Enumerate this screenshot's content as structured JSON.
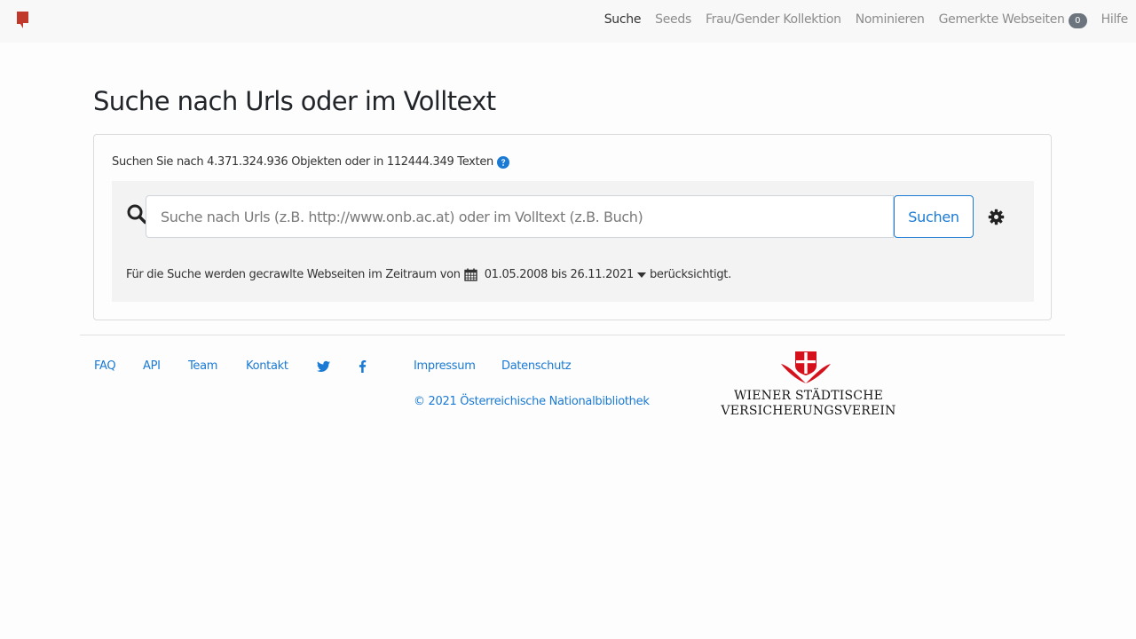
{
  "navbar": {
    "items": [
      {
        "label": "Suche",
        "active": true
      },
      {
        "label": "Seeds"
      },
      {
        "label": "Frau/Gender Kollektion"
      },
      {
        "label": "Nominieren"
      },
      {
        "label": "Gemerkte Webseiten",
        "badge": "0"
      },
      {
        "label": "Hilfe"
      }
    ]
  },
  "page": {
    "title": "Suche nach Urls oder im Volltext"
  },
  "search": {
    "stats_text": "Suchen Sie nach 4.371.324.936 Objekten oder in 112444.349 Texten",
    "placeholder": "Suche nach Urls (z.B. http://www.onb.ac.at) oder im Volltext (z.B. Buch)",
    "value": "",
    "button_label": "Suchen",
    "range_prefix": "Für die Suche werden gecrawlte Webseiten im Zeitraum von",
    "range_dates": "01.05.2008 bis 26.11.2021",
    "range_suffix": "berücksichtigt."
  },
  "footer": {
    "links": [
      {
        "label": "FAQ"
      },
      {
        "label": "API"
      },
      {
        "label": "Team"
      },
      {
        "label": "Kontakt"
      }
    ],
    "legal_links": [
      {
        "label": "Impressum"
      },
      {
        "label": "Datenschutz"
      }
    ],
    "copyright": "© 2021 Österreichische Nationalbibliothek",
    "sponsor_line1": "WIENER STÄDTISCHE",
    "sponsor_line2": "VERSICHERUNGSVEREIN"
  },
  "colors": {
    "accent": "#1a7ad4",
    "brand_red": "#c0392b",
    "sponsor_red": "#d5121c"
  },
  "icons": [
    "bookmark-icon",
    "search-icon",
    "question-circle-icon",
    "gear-icon",
    "calendar-icon",
    "caret-down-icon",
    "twitter-icon",
    "facebook-icon"
  ]
}
